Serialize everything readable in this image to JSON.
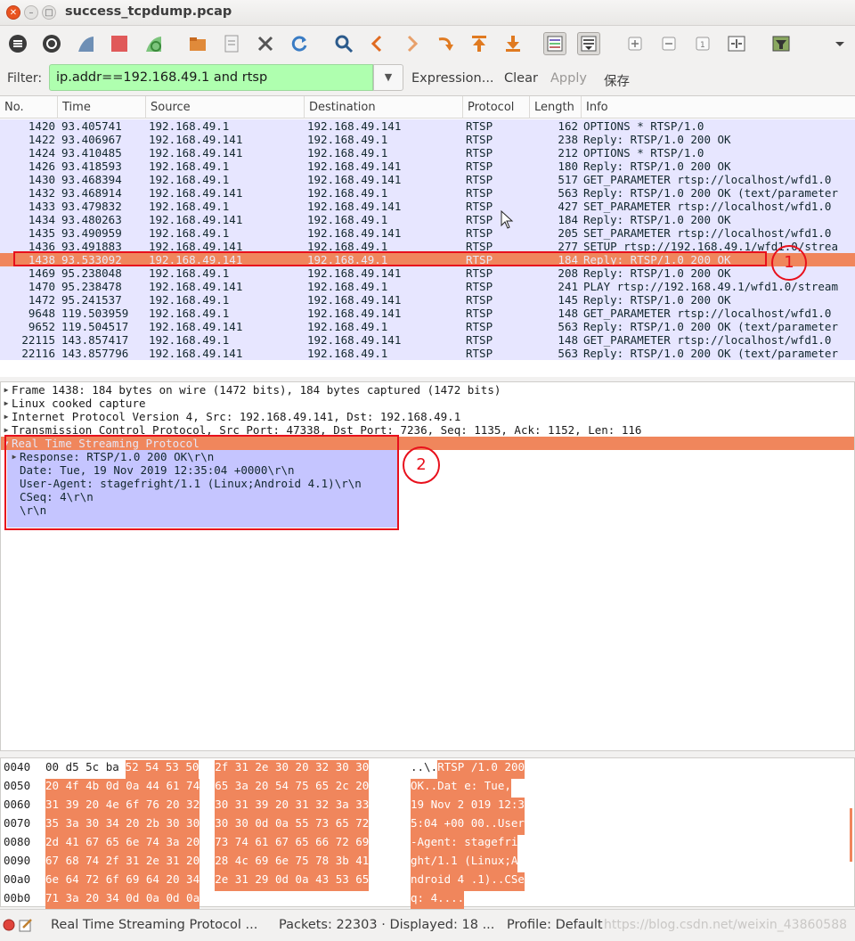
{
  "window": {
    "title": "success_tcpdump.pcap"
  },
  "filter": {
    "label": "Filter:",
    "value": "ip.addr==192.168.49.1 and rtsp",
    "expression": "Expression...",
    "clear": "Clear",
    "apply": "Apply",
    "save": "保存"
  },
  "columns": [
    "No.",
    "Time",
    "Source",
    "Destination",
    "Protocol",
    "Length",
    "Info"
  ],
  "packets": [
    {
      "no": "1420",
      "time": "93.405741",
      "src": "192.168.49.1",
      "dst": "192.168.49.141",
      "proto": "RTSP",
      "len": "162",
      "info": "OPTIONS * RTSP/1.0"
    },
    {
      "no": "1422",
      "time": "93.406967",
      "src": "192.168.49.141",
      "dst": "192.168.49.1",
      "proto": "RTSP",
      "len": "238",
      "info": "Reply: RTSP/1.0 200 OK"
    },
    {
      "no": "1424",
      "time": "93.410485",
      "src": "192.168.49.141",
      "dst": "192.168.49.1",
      "proto": "RTSP",
      "len": "212",
      "info": "OPTIONS * RTSP/1.0"
    },
    {
      "no": "1426",
      "time": "93.418593",
      "src": "192.168.49.1",
      "dst": "192.168.49.141",
      "proto": "RTSP",
      "len": "180",
      "info": "Reply: RTSP/1.0 200 OK"
    },
    {
      "no": "1430",
      "time": "93.468394",
      "src": "192.168.49.1",
      "dst": "192.168.49.141",
      "proto": "RTSP",
      "len": "517",
      "info": "GET_PARAMETER rtsp://localhost/wfd1.0"
    },
    {
      "no": "1432",
      "time": "93.468914",
      "src": "192.168.49.141",
      "dst": "192.168.49.1",
      "proto": "RTSP",
      "len": "563",
      "info": "Reply: RTSP/1.0 200 OK (text/parameter"
    },
    {
      "no": "1433",
      "time": "93.479832",
      "src": "192.168.49.1",
      "dst": "192.168.49.141",
      "proto": "RTSP",
      "len": "427",
      "info": "SET_PARAMETER rtsp://localhost/wfd1.0"
    },
    {
      "no": "1434",
      "time": "93.480263",
      "src": "192.168.49.141",
      "dst": "192.168.49.1",
      "proto": "RTSP",
      "len": "184",
      "info": "Reply: RTSP/1.0 200 OK"
    },
    {
      "no": "1435",
      "time": "93.490959",
      "src": "192.168.49.1",
      "dst": "192.168.49.141",
      "proto": "RTSP",
      "len": "205",
      "info": "SET_PARAMETER rtsp://localhost/wfd1.0"
    },
    {
      "no": "1436",
      "time": "93.491883",
      "src": "192.168.49.141",
      "dst": "192.168.49.1",
      "proto": "RTSP",
      "len": "277",
      "info": "SETUP rtsp://192.168.49.1/wfd1.0/strea"
    },
    {
      "no": "1438",
      "time": "93.533092",
      "src": "192.168.49.141",
      "dst": "192.168.49.1",
      "proto": "RTSP",
      "len": "184",
      "info": "Reply: RTSP/1.0 200 OK",
      "selected": true
    },
    {
      "no": "1469",
      "time": "95.238048",
      "src": "192.168.49.1",
      "dst": "192.168.49.141",
      "proto": "RTSP",
      "len": "208",
      "info": "Reply: RTSP/1.0 200 OK"
    },
    {
      "no": "1470",
      "time": "95.238478",
      "src": "192.168.49.141",
      "dst": "192.168.49.1",
      "proto": "RTSP",
      "len": "241",
      "info": "PLAY rtsp://192.168.49.1/wfd1.0/stream"
    },
    {
      "no": "1472",
      "time": "95.241537",
      "src": "192.168.49.1",
      "dst": "192.168.49.141",
      "proto": "RTSP",
      "len": "145",
      "info": "Reply: RTSP/1.0 200 OK"
    },
    {
      "no": "9648",
      "time": "119.503959",
      "src": "192.168.49.1",
      "dst": "192.168.49.141",
      "proto": "RTSP",
      "len": "148",
      "info": "GET_PARAMETER rtsp://localhost/wfd1.0"
    },
    {
      "no": "9652",
      "time": "119.504517",
      "src": "192.168.49.141",
      "dst": "192.168.49.1",
      "proto": "RTSP",
      "len": "563",
      "info": "Reply: RTSP/1.0 200 OK (text/parameter"
    },
    {
      "no": "22115",
      "time": "143.857417",
      "src": "192.168.49.1",
      "dst": "192.168.49.141",
      "proto": "RTSP",
      "len": "148",
      "info": "GET_PARAMETER rtsp://localhost/wfd1.0"
    },
    {
      "no": "22116",
      "time": "143.857796",
      "src": "192.168.49.141",
      "dst": "192.168.49.1",
      "proto": "RTSP",
      "len": "563",
      "info": "Reply: RTSP/1.0 200 OK (text/parameter"
    }
  ],
  "details": {
    "frame": "Frame 1438: 184 bytes on wire (1472 bits), 184 bytes captured (1472 bits)",
    "linux": "Linux cooked capture",
    "ip": "Internet Protocol Version 4, Src: 192.168.49.141, Dst: 192.168.49.1",
    "tcp": "Transmission Control Protocol, Src Port: 47338, Dst Port: 7236, Seq: 1135, Ack: 1152, Len: 116",
    "rtsp": "Real Time Streaming Protocol",
    "rtsp_lines": [
      "Response: RTSP/1.0 200 OK\\r\\n",
      "Date: Tue, 19 Nov 2019 12:35:04 +0000\\r\\n",
      "User-Agent: stagefright/1.1 (Linux;Android 4.1)\\r\\n",
      "CSeq: 4\\r\\n",
      "\\r\\n"
    ]
  },
  "hex": [
    {
      "off": "0040",
      "plain": "00 d5 5c ba",
      "hl1": "52 54 53 50",
      "hl2": "2f 31 2e 30 20 32 30 30",
      "ascii_plain": "..\\.",
      "ascii_hl": "RTSP /1.0 200"
    },
    {
      "off": "0050",
      "plain": "",
      "hl1": "20 4f 4b 0d 0a 44 61 74",
      "hl2": "65 3a 20 54 75 65 2c 20",
      "ascii_plain": "",
      "ascii_hl": " OK..Dat e: Tue, "
    },
    {
      "off": "0060",
      "plain": "",
      "hl1": "31 39 20 4e 6f 76 20 32",
      "hl2": "30 31 39 20 31 32 3a 33",
      "ascii_plain": "",
      "ascii_hl": "19 Nov 2 019 12:3"
    },
    {
      "off": "0070",
      "plain": "",
      "hl1": "35 3a 30 34 20 2b 30 30",
      "hl2": "30 30 0d 0a 55 73 65 72",
      "ascii_plain": "",
      "ascii_hl": "5:04 +00 00..User"
    },
    {
      "off": "0080",
      "plain": "",
      "hl1": "2d 41 67 65 6e 74 3a 20",
      "hl2": "73 74 61 67 65 66 72 69",
      "ascii_plain": "",
      "ascii_hl": "-Agent:  stagefri"
    },
    {
      "off": "0090",
      "plain": "",
      "hl1": "67 68 74 2f 31 2e 31 20",
      "hl2": "28 4c 69 6e 75 78 3b 41",
      "ascii_plain": "",
      "ascii_hl": "ght/1.1  (Linux;A"
    },
    {
      "off": "00a0",
      "plain": "",
      "hl1": "6e 64 72 6f 69 64 20 34",
      "hl2": "2e 31 29 0d 0a 43 53 65",
      "ascii_plain": "",
      "ascii_hl": "ndroid 4 .1)..CSe"
    },
    {
      "off": "00b0",
      "plain": "",
      "hl1": "71 3a 20 34 0d 0a 0d 0a",
      "hl2": "",
      "ascii_plain": "",
      "ascii_hl": "q: 4...."
    }
  ],
  "status": {
    "protocol": "Real Time Streaming Protocol ...",
    "packets": "Packets: 22303 · Displayed: 18 ...",
    "profile": "Profile: Default",
    "watermark": "https://blog.csdn.net/weixin_43860588"
  },
  "annotations": {
    "one": "1",
    "two": "2"
  },
  "colors": {
    "row": "#e7e6ff",
    "selected": "#f0865c",
    "filter_ok": "#afffaf",
    "annot": "#e8101c"
  }
}
